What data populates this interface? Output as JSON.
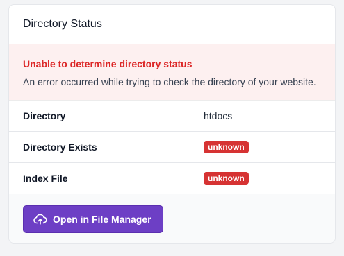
{
  "card": {
    "title": "Directory Status"
  },
  "alert": {
    "title": "Unable to determine directory status",
    "message": "An error occurred while trying to check the directory of your website.",
    "color": "#dc2626"
  },
  "rows": [
    {
      "label": "Directory",
      "value": "htdocs"
    },
    {
      "label": "Directory Exists",
      "value": "unknown"
    },
    {
      "label": "Index File",
      "value": "unknown"
    }
  ],
  "footer": {
    "button_label": "Open in File Manager",
    "button_icon": "cloud-upload-icon",
    "button_color": "#6d3fc5"
  },
  "badge_color": "#d63333"
}
